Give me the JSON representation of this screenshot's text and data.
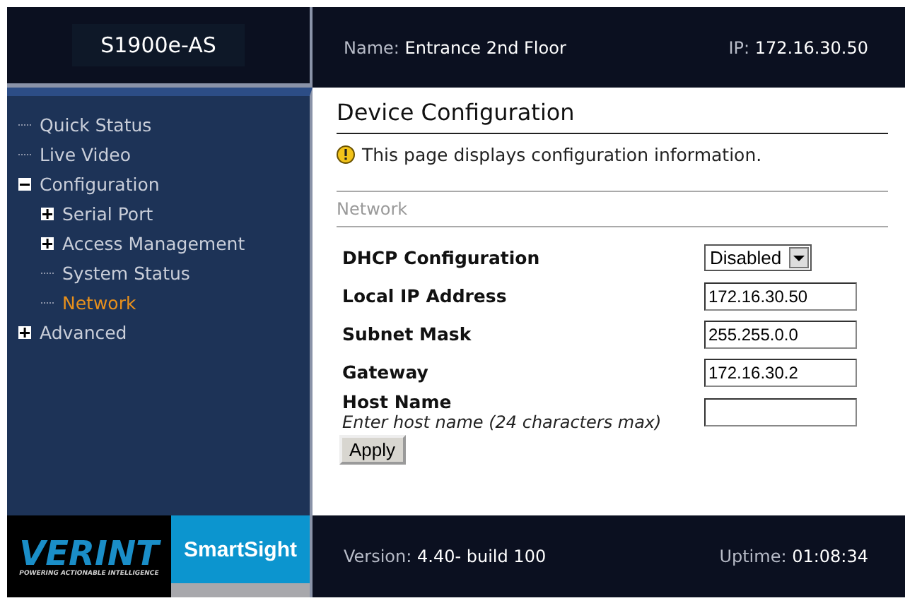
{
  "header": {
    "device": "S1900e-AS",
    "name_label": "Name:",
    "name_value": "Entrance 2nd Floor",
    "ip_label": "IP:",
    "ip_value": "172.16.30.50"
  },
  "sidebar": {
    "items": [
      {
        "label": "Quick Status",
        "selected": false
      },
      {
        "label": "Live Video",
        "selected": false
      },
      {
        "label": "Configuration",
        "selected": false,
        "expanded": true,
        "children": [
          {
            "label": "Serial Port",
            "selected": false,
            "expanded": false
          },
          {
            "label": "Access Management",
            "selected": false,
            "expanded": false
          },
          {
            "label": "System Status",
            "selected": false
          },
          {
            "label": "Network",
            "selected": true
          }
        ]
      },
      {
        "label": "Advanced",
        "selected": false,
        "expanded": false
      }
    ]
  },
  "content": {
    "title": "Device Configuration",
    "info": "This page displays configuration information.",
    "section": "Network",
    "fields": [
      {
        "kind": "select",
        "label": "DHCP Configuration",
        "value": "Disabled"
      },
      {
        "kind": "text",
        "label": "Local IP Address",
        "value": "172.16.30.50"
      },
      {
        "kind": "text",
        "label": "Subnet Mask",
        "value": "255.255.0.0"
      },
      {
        "kind": "text",
        "label": "Gateway",
        "value": "172.16.30.2"
      },
      {
        "kind": "text",
        "label": "Host Name",
        "hint": "Enter host name (24 characters max)"
      }
    ],
    "button": "Apply"
  },
  "footer": {
    "logo": "VERINT",
    "tagline": "POWERING ACTIONABLE INTELLIGENCE",
    "product": "SmartSight",
    "version_label": "Version:",
    "version_value": "4.40- build 100",
    "uptime_label": "Uptime:",
    "uptime_value": "01:08:34"
  }
}
